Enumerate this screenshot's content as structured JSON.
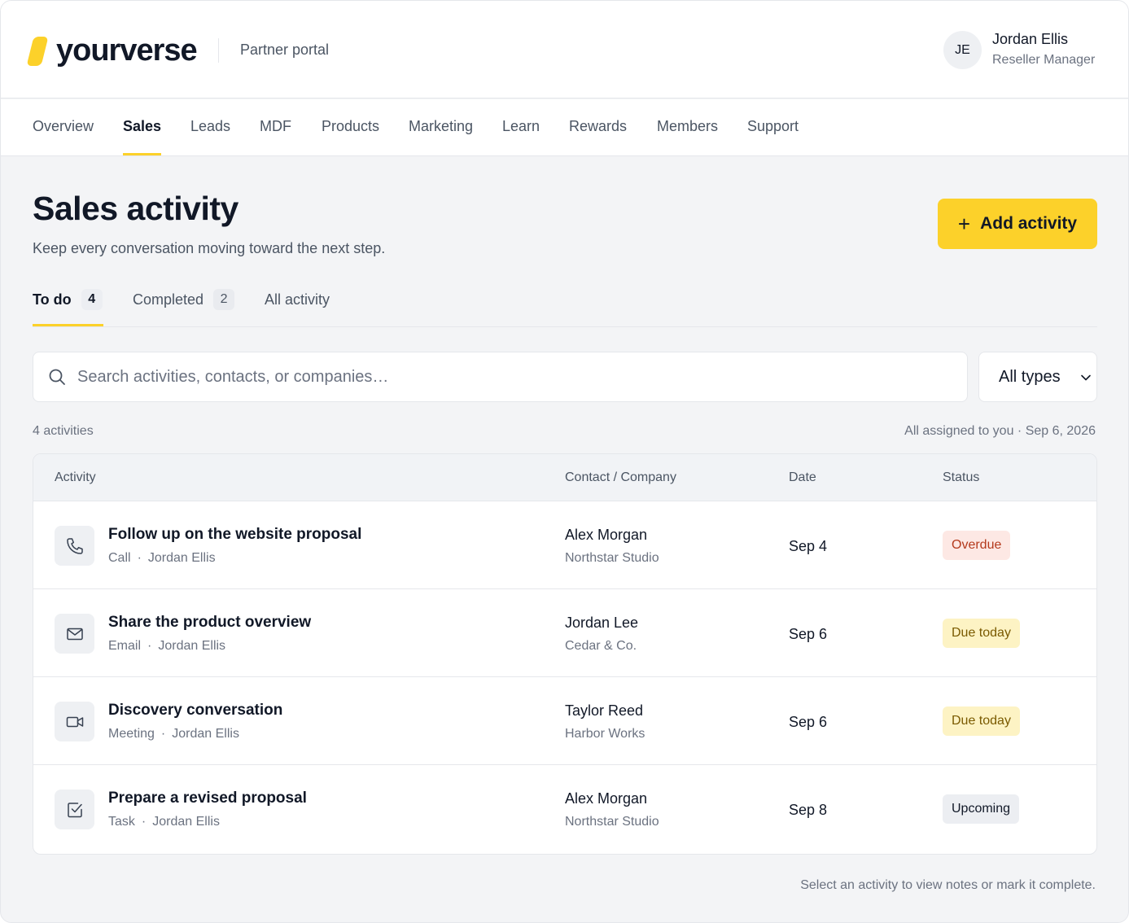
{
  "header": {
    "brand": "yourverse",
    "portal": "Partner portal",
    "user": {
      "initials": "JE",
      "name": "Jordan Ellis",
      "role": "Reseller Manager"
    }
  },
  "nav": {
    "items": [
      "Overview",
      "Sales",
      "Leads",
      "MDF",
      "Products",
      "Marketing",
      "Learn",
      "Rewards",
      "Members",
      "Support"
    ],
    "active": "Sales"
  },
  "page": {
    "title": "Sales activity",
    "subtitle": "Keep every conversation moving toward the next step.",
    "add_button": "Add activity"
  },
  "tabs": [
    {
      "label": "To do",
      "count": "4",
      "active": true
    },
    {
      "label": "Completed",
      "count": "2",
      "active": false
    },
    {
      "label": "All activity",
      "count": "",
      "active": false
    }
  ],
  "filters": {
    "search_placeholder": "Search activities, contacts, or companies…",
    "type_select": "All types"
  },
  "summary": {
    "count_text": "4 activities",
    "meta_text": "All assigned to you · Sep 6, 2026"
  },
  "table": {
    "headers": {
      "activity": "Activity",
      "contact": "Contact / Company",
      "date": "Date",
      "status": "Status"
    },
    "rows": [
      {
        "icon": "phone-icon",
        "title": "Follow up on the website proposal",
        "type": "Call",
        "owner": "Jordan Ellis",
        "contact": "Alex Morgan",
        "company": "Northstar Studio",
        "date": "Sep 4",
        "status": "Overdue",
        "status_kind": "overdue"
      },
      {
        "icon": "mail-icon",
        "title": "Share the product overview",
        "type": "Email",
        "owner": "Jordan Ellis",
        "contact": "Jordan Lee",
        "company": "Cedar & Co.",
        "date": "Sep 6",
        "status": "Due today",
        "status_kind": "due"
      },
      {
        "icon": "video-icon",
        "title": "Discovery conversation",
        "type": "Meeting",
        "owner": "Jordan Ellis",
        "contact": "Taylor Reed",
        "company": "Harbor Works",
        "date": "Sep 6",
        "status": "Due today",
        "status_kind": "due"
      },
      {
        "icon": "checkbox-icon",
        "title": "Prepare a revised proposal",
        "type": "Task",
        "owner": "Jordan Ellis",
        "contact": "Alex Morgan",
        "company": "Northstar Studio",
        "date": "Sep 8",
        "status": "Upcoming",
        "status_kind": "upcoming"
      }
    ]
  },
  "colors": {
    "accent": "#fcd12a",
    "overdue_bg": "#fde8e4",
    "overdue_text": "#b4391c",
    "due_bg": "#fdf3c4",
    "due_text": "#7a5a00",
    "upcoming_bg": "#eceef2",
    "upcoming_text": "#111827"
  },
  "footer": {
    "hint": "Select an activity to view notes or mark it complete."
  }
}
